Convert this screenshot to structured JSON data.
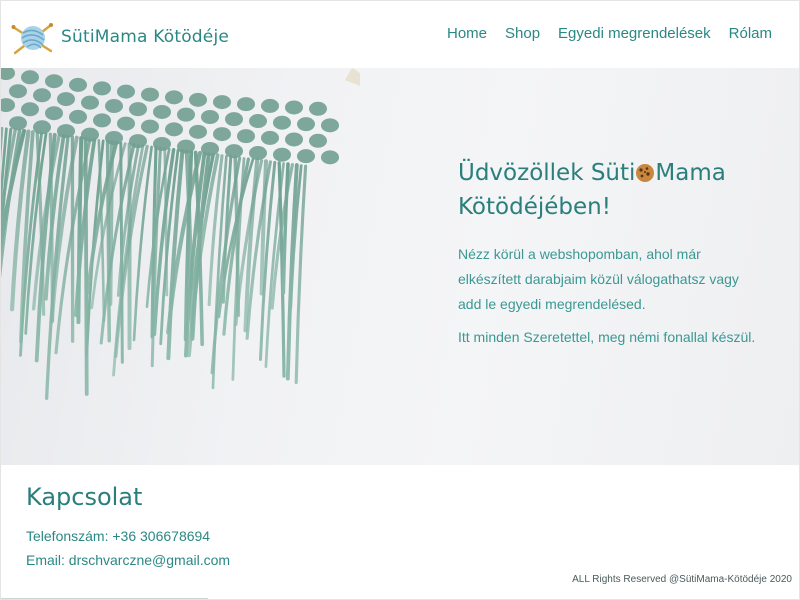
{
  "brand": {
    "name": "SütiMama Kötödéje",
    "logo_icon": "yarn-ball-knitting-needles-icon"
  },
  "nav": {
    "items": [
      {
        "label": "Home"
      },
      {
        "label": "Shop"
      },
      {
        "label": "Egyedi megrendelések"
      },
      {
        "label": "Rólam"
      }
    ]
  },
  "hero": {
    "image": "green-macrame-fringe-photo",
    "title_part1": "Üdvözöllek Süti",
    "title_icon": "cookie-icon",
    "title_part2": "Mama Kötödéjében!",
    "paragraph1": "Nézz körül a webshopomban, ahol már elkészített darabjaim közül válogathatsz vagy add le egyedi megrendelésed.",
    "paragraph2": "Itt minden Szeretettel, meg némi fonallal készül."
  },
  "footer": {
    "contact_title": "Kapcsolat",
    "phone": "Telefonszám: +36 306678694",
    "email": "Email: drschvarczne@gmail.com",
    "copyright": "ALL Rights Reserved @SütiMama-Kötödéje 2020"
  },
  "colors": {
    "accent": "#2a8884",
    "hero_bg": "#f1f2f4",
    "macrame": "#7fab9b"
  }
}
